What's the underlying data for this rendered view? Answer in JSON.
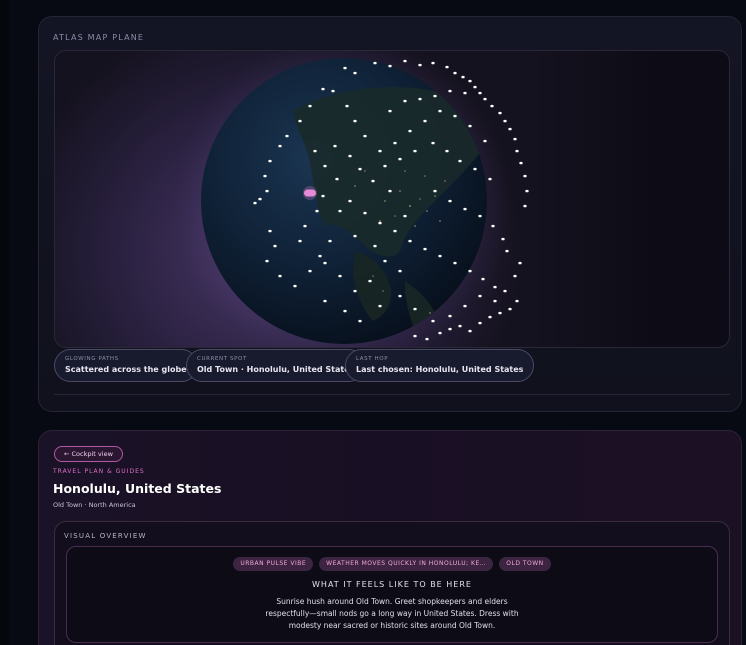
{
  "map_panel": {
    "title": "ATLAS MAP PLANE"
  },
  "chips": [
    {
      "label": "GLOWING PATHS",
      "value": "Scattered across the globe"
    },
    {
      "label": "CURRENT SPOT",
      "value": "Old Town · Honolulu, United States"
    },
    {
      "label": "LAST HOP",
      "value": "Last chosen: Honolulu, United States"
    }
  ],
  "guide": {
    "back_label": "← Cockpit view",
    "eyebrow": "TRAVEL PLAN & GUIDES",
    "title": "Honolulu, United States",
    "subtitle": "Old Town · North America",
    "visual_title": "VISUAL OVERVIEW",
    "tags": [
      "URBAN PULSE VIBE",
      "WEATHER MOVES QUICKLY IN HONOLULU; KE…",
      "OLD TOWN"
    ],
    "feel_heading": "WHAT IT FEELS LIKE TO BE HERE",
    "description": "Sunrise hush around Old Town. Greet shopkeepers and elders respectfully—small nods go a long way in United States. Dress with modesty near sacred or historic sites around Old Town."
  },
  "colors": {
    "accent": "#e070c8",
    "marker": "#e48ad6",
    "dot": "#ffffff"
  }
}
